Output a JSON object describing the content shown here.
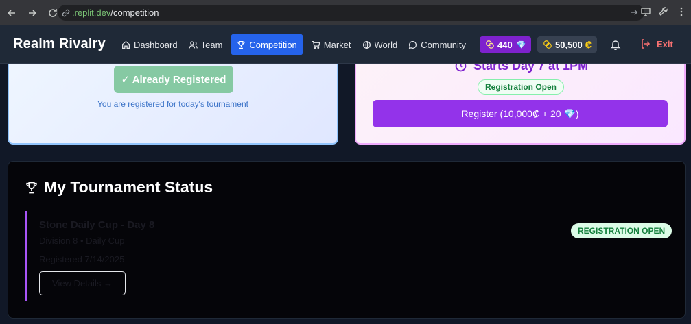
{
  "browser": {
    "url_domain": ".replit.dev",
    "url_path": "/competition"
  },
  "header": {
    "logo": "Realm Rivalry",
    "nav": [
      {
        "label": "Dashboard",
        "icon": "home-icon"
      },
      {
        "label": "Team",
        "icon": "users-icon"
      },
      {
        "label": "Competition",
        "icon": "trophy-icon",
        "active": true
      },
      {
        "label": "Market",
        "icon": "cart-icon"
      },
      {
        "label": "World",
        "icon": "globe-icon"
      },
      {
        "label": "Community",
        "icon": "chat-icon"
      }
    ],
    "gems": "440",
    "coins": "50,500",
    "coin_symbol": "₡",
    "exit_label": "Exit"
  },
  "left_card": {
    "button_label": "✓ Already Registered",
    "note": "You are registered for today's tournament"
  },
  "right_card": {
    "starts_label": "Starts Day 7 at 1PM",
    "badge": "Registration Open",
    "register_label": "Register (10,000₡ + 20 💎)"
  },
  "status": {
    "title": "My Tournament Status",
    "tournament": {
      "name": "Stone Daily Cup - Day 8",
      "division": "Division 8 • Daily Cup",
      "registered": "Registered 7/14/2025",
      "view_label": "View Details →",
      "badge": "REGISTRATION OPEN"
    }
  },
  "colors": {
    "accent": "#2563eb",
    "gem": "#7e22ce",
    "tournament_bar": "#a855f7",
    "success": "#15803d"
  }
}
